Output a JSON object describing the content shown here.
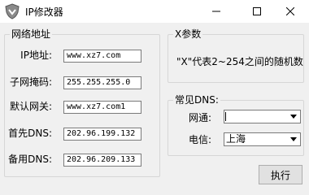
{
  "window": {
    "title": "IP修改器",
    "controls": {
      "minimize_icon": "minimize-icon",
      "maximize_icon": "maximize-icon",
      "close_icon": "close-icon"
    }
  },
  "network_group": {
    "legend": "网络地址",
    "fields": [
      {
        "label": "IP地址:",
        "value": "www.xz7.com"
      },
      {
        "label": "子网掩码:",
        "value": "255.255.255.0"
      },
      {
        "label": "默认网关:",
        "value": "www.xz7.com1"
      },
      {
        "label": "首先DNS:",
        "value": "202.96.199.132"
      },
      {
        "label": "备用DNS:",
        "value": "202.96.209.133"
      }
    ]
  },
  "x_group": {
    "legend": "X参数",
    "note": "\"X\"代表2~254之间的随机数"
  },
  "dns_group": {
    "legend": "常见DNS:",
    "isp_label": "网通:",
    "isp_value": "",
    "telecom_label": "电信:",
    "telecom_value": "上海"
  },
  "run_button": "执行"
}
